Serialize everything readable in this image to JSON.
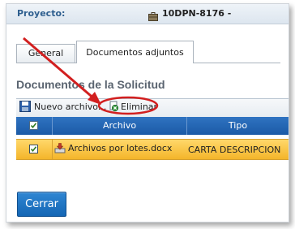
{
  "project": {
    "label": "Proyecto:",
    "value": "10DPN-8176 -"
  },
  "tabs": [
    {
      "label": "General",
      "active": false
    },
    {
      "label": "Documentos adjuntos",
      "active": true
    }
  ],
  "section": {
    "title": "Documentos de la Solicitud"
  },
  "toolbar": {
    "new_label": "Nuevo archivo...",
    "delete_label": "Eliminar"
  },
  "table": {
    "columns": [
      "Archivo",
      "Tipo"
    ],
    "rows": [
      {
        "archivo": "Archivos por lotes.docx",
        "tipo": "CARTA DESCRIPCION",
        "checked": true,
        "selected": true
      }
    ]
  },
  "footer": {
    "close_label": "Cerrar"
  },
  "colors": {
    "accent": "#1b5aa6",
    "selected_row": "#f4b52a",
    "annotation": "#d21f1f"
  }
}
